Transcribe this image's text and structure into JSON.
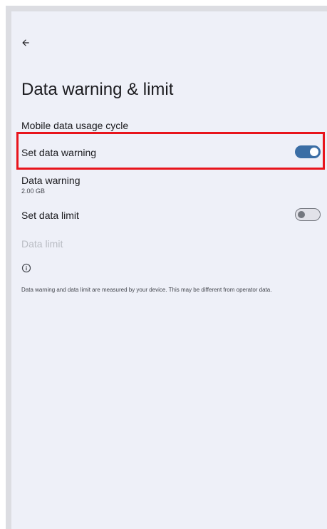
{
  "page": {
    "title": "Data warning & limit"
  },
  "icons": {
    "back": "arrow-back-icon",
    "info": "info-icon"
  },
  "colors": {
    "accent": "#3b6ea5",
    "highlight": "#e8141c",
    "background": "#eef0f8",
    "disabled_text": "#b9bcc3"
  },
  "settings": {
    "usage_cycle": {
      "label": "Mobile data usage cycle"
    },
    "set_data_warning": {
      "label": "Set data warning",
      "enabled": true
    },
    "data_warning": {
      "label": "Data warning",
      "value": "2.00 GB"
    },
    "set_data_limit": {
      "label": "Set data limit",
      "enabled": false
    },
    "data_limit": {
      "label": "Data limit",
      "disabled": true
    }
  },
  "footer": {
    "note": "Data warning and data limit are measured by your device. This may be different from operator data."
  }
}
